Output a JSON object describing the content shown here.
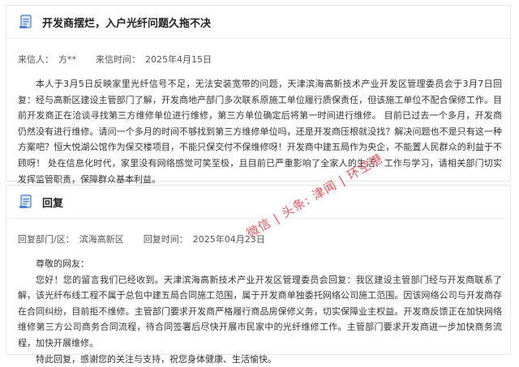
{
  "complaint": {
    "title": "开发商摆烂，入户光纤问题久拖不决",
    "sender_label": "来信人：",
    "sender_value": "方**",
    "time_label": "来信时间：",
    "time_value": "2025年4月15日",
    "body": "本人于3月5日反映家里光纤信号不足，无法安装宽带的问题，天津滨海高新技术产业开发区管理委员会于3月7日回复：经与高新区建设主管部门了解，开发商地产部门多次联系原施工单位履行质保责任，但该施工单位不配合保修工作。目前开发商正在洽谈寻找第三方维修单位进行维修，第三方单位确定后将第一时间进行维修。 目前已过去一个多月，开发商仍然没有进行维修。请问一个多月的时间不够找到第三方维修单位吗，还是开发商压根就没找？解决问题也不是只有这一种方案吧？恒大悦湖公馆作为保交楼项目，不能只保交付不保维修呀！开发商中建五局作为央企，不能置人民群众的利益于不顾呀！ 处在信息化时代，家里没有网络感觉可笑至极，且目前已严重影响了全家人的生活、工作与学习，请相关部门切实发挥监管职责，保障群众基本利益。"
  },
  "reply": {
    "title": "回复",
    "dept_label": "回复部门/区：",
    "dept_value": "滨海高新区",
    "time_label": "回复时间：",
    "time_value": "2025年04月23日",
    "greeting": "尊敬的网友：",
    "body": "您好！您的留言我们已经收到。天津滨海高新技术产业开发区管理委员会回复：我区建设主管部门经与开发商联系了解，该光纤布线工程不属于总包中建五局合同施工范围，属于开发商单独委托网络公司施工范围。因该网络公司与开发商存在合同纠纷，目前拒不维修。主管部门要求开发商严格履行商品房保修义务，切实保障业主权益。开发商反馈正在加快网络维修第三方公司商务合同流程，待合同签署后尽快开展市民家中的光纤维修工作。主管部门要求开发商进一步加快商务流程，加快开展维修。",
    "closing": "特此回复，感谢您的关注与支持，祝您身体健康、生活愉快。"
  },
  "watermark": "微信 | 头条: 津闻 | 环空港",
  "colors": {
    "accent": "#4a7fd6",
    "watermark": "#e8474f"
  }
}
